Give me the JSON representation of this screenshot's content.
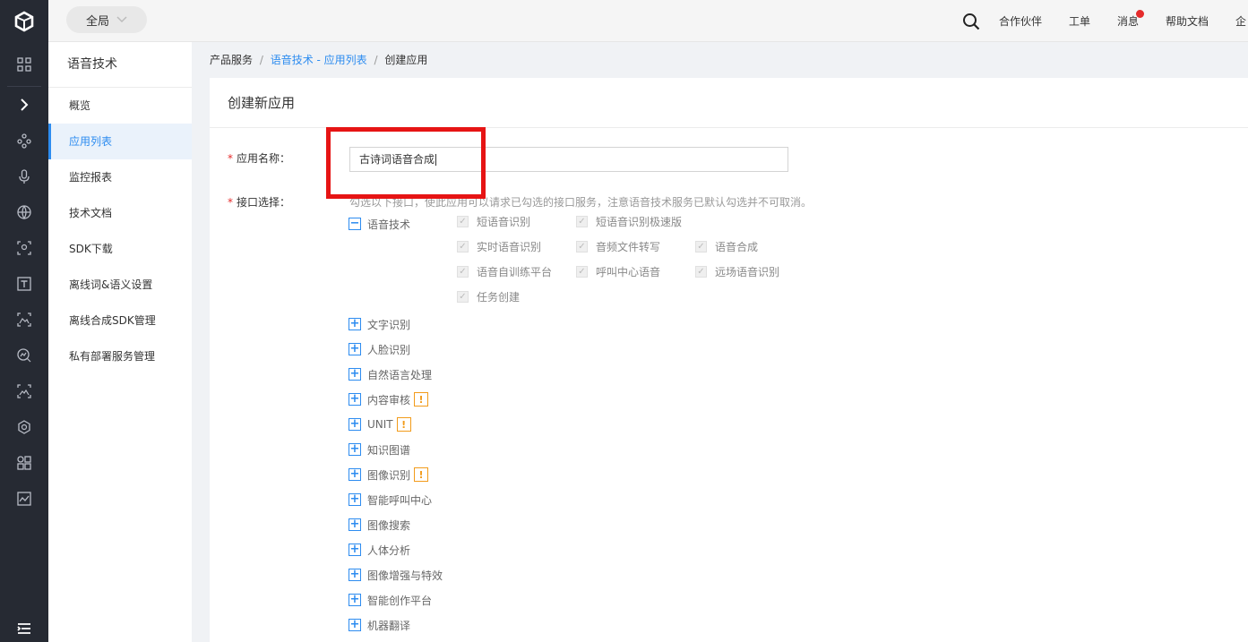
{
  "topbar": {
    "scope_label": "全局",
    "nav": [
      "合作伙伴",
      "工单",
      "消息",
      "帮助文档",
      "企"
    ]
  },
  "sidebar": {
    "title": "语音技术",
    "items": [
      "概览",
      "应用列表",
      "监控报表",
      "技术文档",
      "SDK下载",
      "离线词&语义设置",
      "离线合成SDK管理",
      "私有部署服务管理"
    ],
    "active_index": 1
  },
  "breadcrumb": {
    "root": "产品服务",
    "middle": "语音技术 - 应用列表",
    "current": "创建应用"
  },
  "form": {
    "card_title": "创建新应用",
    "name_label": "应用名称：",
    "name_value": "古诗词语音合成",
    "api_label": "接口选择：",
    "api_hint": "勾选以下接口，使此应用可以请求已勾选的接口服务，注意语音技术服务已默认勾选并不可取消。",
    "expanded_group": "语音技术",
    "voice_services": [
      "短语音识别",
      "短语音识别极速版",
      "实时语音识别",
      "音频文件转写",
      "语音合成",
      "语音自训练平台",
      "呼叫中心语音",
      "远场语音识别",
      "任务创建"
    ],
    "collapsed_groups": [
      {
        "label": "文字识别",
        "warn": false
      },
      {
        "label": "人脸识别",
        "warn": false
      },
      {
        "label": "自然语言处理",
        "warn": false
      },
      {
        "label": "内容审核",
        "warn": true
      },
      {
        "label": "UNIT",
        "warn": true
      },
      {
        "label": "知识图谱",
        "warn": false
      },
      {
        "label": "图像识别",
        "warn": true
      },
      {
        "label": "智能呼叫中心",
        "warn": false
      },
      {
        "label": "图像搜索",
        "warn": false
      },
      {
        "label": "人体分析",
        "warn": false
      },
      {
        "label": "图像增强与特效",
        "warn": false
      },
      {
        "label": "智能创作平台",
        "warn": false
      },
      {
        "label": "机器翻译",
        "warn": false
      }
    ]
  },
  "icons": {
    "logo": "cube-logo-icon",
    "search": "search-icon",
    "warning": "warning-icon",
    "expand": "plus-square-icon",
    "collapse": "minus-square-icon",
    "check": "checkmark-icon"
  },
  "colors": {
    "accent": "#2d8cf0",
    "rail": "#262a33",
    "highlight": "#e61414",
    "warning": "#f29b1a",
    "badge": "#e52b2b"
  }
}
